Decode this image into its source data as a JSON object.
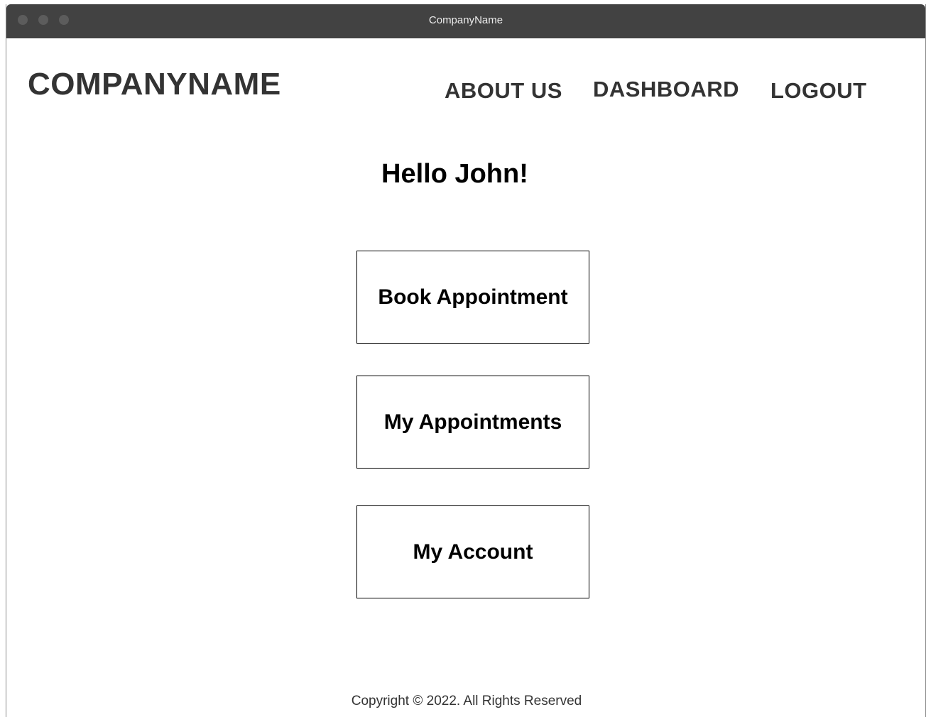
{
  "window": {
    "title": "CompanyName"
  },
  "header": {
    "logo": "COMPANYNAME",
    "nav": {
      "about": "ABOUT US",
      "dashboard": "DASHBOARD",
      "logout": "LOGOUT"
    }
  },
  "main": {
    "greeting": "Hello John!",
    "actions": {
      "book": "Book Appointment",
      "appointments": "My Appointments",
      "account": "My Account"
    }
  },
  "footer": {
    "copyright": "Copyright  © 2022. All Rights Reserved"
  }
}
